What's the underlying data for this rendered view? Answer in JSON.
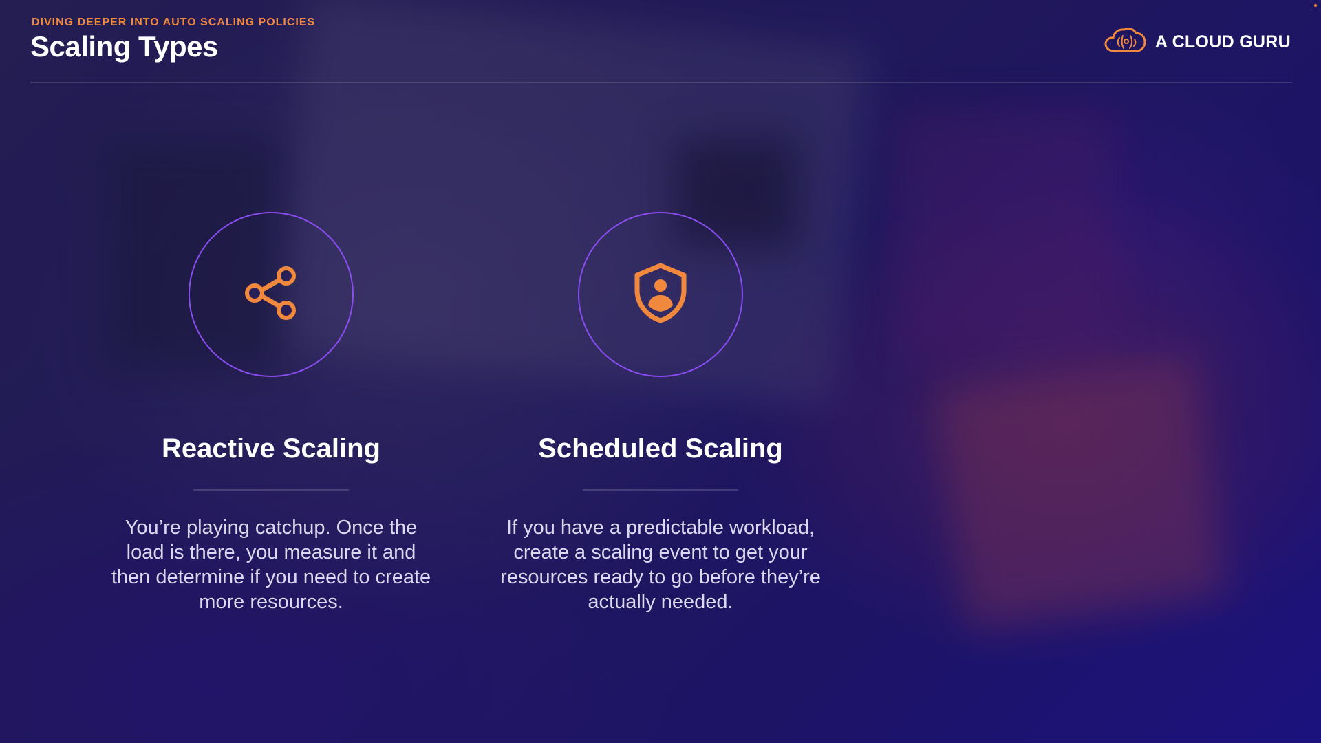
{
  "header": {
    "eyebrow": "DIVING DEEPER INTO AUTO SCALING POLICIES",
    "title": "Scaling Types"
  },
  "brand": {
    "name": "A CLOUD GURU",
    "icon": "cloud-logo-icon"
  },
  "cards": [
    {
      "icon": "share-icon",
      "title": "Reactive Scaling",
      "text": "You’re playing catchup. Once the load is there, you measure it and then determine if you need to create more resources."
    },
    {
      "icon": "shield-user-icon",
      "title": "Scheduled Scaling",
      "text": "If you have a predictable workload, create a scaling event to get your resources ready to go before they’re actually needed."
    }
  ],
  "colors": {
    "accent_orange": "#f0883e",
    "circle_border": "#8a4ef0",
    "background": "#1c1550"
  }
}
